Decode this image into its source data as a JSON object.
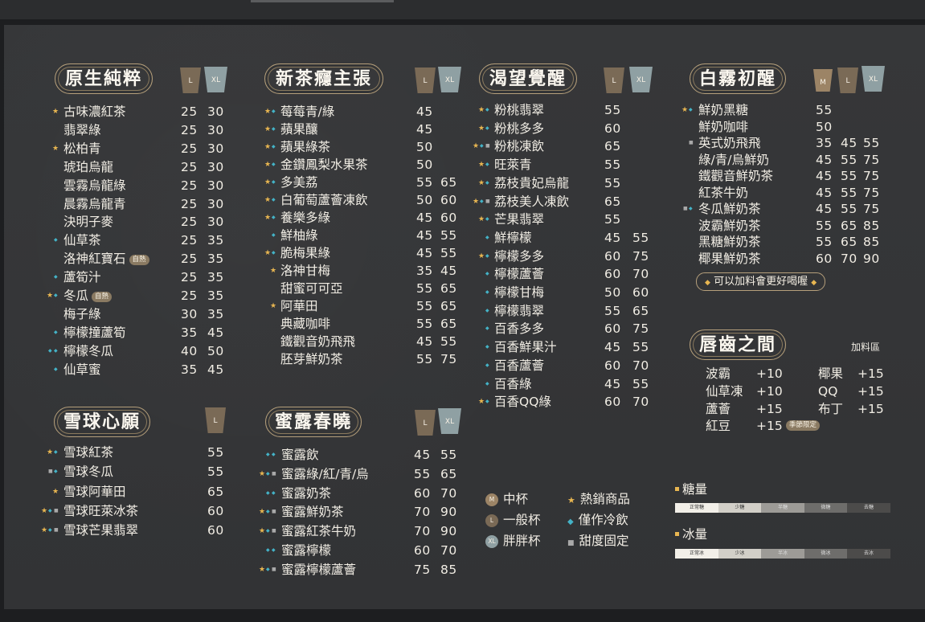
{
  "colors": {
    "board": "#333436",
    "gold": "#e8b651",
    "cold": "#44b3c7",
    "cup_L": "#7a6a56",
    "cup_XL": "#8fa0a3",
    "cup_M": "#9c8466"
  },
  "cups": {
    "M": "M",
    "L": "L",
    "XL": "XL"
  },
  "tag_natural": "自熱",
  "tag_seasonal": "季節限定",
  "sections": {
    "s1": {
      "title": "原生純粹",
      "items": [
        {
          "name": "古味濃紅茶",
          "L": "25",
          "XL": "30",
          "marks": [
            "star"
          ]
        },
        {
          "name": "翡翠綠",
          "L": "25",
          "XL": "30",
          "marks": []
        },
        {
          "name": "松柏青",
          "L": "25",
          "XL": "30",
          "marks": [
            "star"
          ]
        },
        {
          "name": "琥珀烏龍",
          "L": "25",
          "XL": "30",
          "marks": []
        },
        {
          "name": "雲霧烏龍綠",
          "L": "25",
          "XL": "30",
          "marks": []
        },
        {
          "name": "晨霧烏龍青",
          "L": "25",
          "XL": "30",
          "marks": []
        },
        {
          "name": "決明子麥",
          "L": "25",
          "XL": "30",
          "marks": []
        },
        {
          "name": "仙草茶",
          "L": "25",
          "XL": "35",
          "marks": [
            "cold"
          ]
        },
        {
          "name": "洛神紅寶石",
          "L": "25",
          "XL": "35",
          "marks": [],
          "tag": "自熱"
        },
        {
          "name": "蘆筍汁",
          "L": "25",
          "XL": "35",
          "marks": [
            "cold"
          ]
        },
        {
          "name": "冬瓜",
          "L": "25",
          "XL": "35",
          "marks": [
            "star",
            "cold"
          ],
          "tag": "自熱"
        },
        {
          "name": "梅子綠",
          "L": "30",
          "XL": "35",
          "marks": []
        },
        {
          "name": "檸檬撞蘆筍",
          "L": "35",
          "XL": "45",
          "marks": [
            "cold"
          ]
        },
        {
          "name": "檸檬冬瓜",
          "L": "40",
          "XL": "50",
          "marks": [
            "cold",
            "cold"
          ]
        },
        {
          "name": "仙草蜜",
          "L": "35",
          "XL": "45",
          "marks": [
            "cold"
          ]
        }
      ]
    },
    "s2": {
      "title": "新茶癮主張",
      "items": [
        {
          "name": "莓莓青/綠",
          "L": "45",
          "XL": "",
          "marks": [
            "star",
            "cold"
          ]
        },
        {
          "name": "蘋果釀",
          "L": "45",
          "XL": "",
          "marks": [
            "star",
            "cold"
          ]
        },
        {
          "name": "蘋果綠茶",
          "L": "50",
          "XL": "",
          "marks": [
            "star",
            "cold"
          ]
        },
        {
          "name": "金鑽鳳梨水果茶",
          "L": "50",
          "XL": "",
          "marks": [
            "star",
            "cold"
          ]
        },
        {
          "name": "多美荔",
          "L": "55",
          "XL": "65",
          "marks": [
            "star",
            "cold"
          ]
        },
        {
          "name": "白葡萄蘆薈凍飲",
          "L": "50",
          "XL": "60",
          "marks": [
            "star",
            "cold"
          ]
        },
        {
          "name": "養樂多綠",
          "L": "45",
          "XL": "60",
          "marks": [
            "star",
            "cold"
          ]
        },
        {
          "name": "鮮柚綠",
          "L": "45",
          "XL": "55",
          "marks": [
            "cold"
          ]
        },
        {
          "name": "脆梅果綠",
          "L": "45",
          "XL": "55",
          "marks": [
            "star",
            "cold"
          ]
        },
        {
          "name": "洛神甘梅",
          "L": "35",
          "XL": "45",
          "marks": [
            "star"
          ]
        },
        {
          "name": "甜蜜可可亞",
          "L": "55",
          "XL": "65",
          "marks": []
        },
        {
          "name": "阿華田",
          "L": "55",
          "XL": "65",
          "marks": [
            "star"
          ]
        },
        {
          "name": "典藏咖啡",
          "L": "55",
          "XL": "65",
          "marks": []
        },
        {
          "name": "鐵觀音奶飛飛",
          "L": "45",
          "XL": "55",
          "marks": []
        },
        {
          "name": "胚芽鮮奶茶",
          "L": "55",
          "XL": "75",
          "marks": []
        }
      ]
    },
    "s3": {
      "title": "渴望覺醒",
      "items": [
        {
          "name": "粉桃翡翠",
          "L": "55",
          "XL": "",
          "marks": [
            "star",
            "cold"
          ]
        },
        {
          "name": "粉桃多多",
          "L": "60",
          "XL": "",
          "marks": [
            "star",
            "cold"
          ]
        },
        {
          "name": "粉桃凍飲",
          "L": "65",
          "XL": "",
          "marks": [
            "star",
            "cold",
            "fix"
          ]
        },
        {
          "name": "旺萊青",
          "L": "55",
          "XL": "",
          "marks": [
            "star",
            "cold"
          ]
        },
        {
          "name": "荔枝貴妃烏龍",
          "L": "55",
          "XL": "",
          "marks": [
            "star",
            "cold"
          ]
        },
        {
          "name": "荔枝美人凍飲",
          "L": "65",
          "XL": "",
          "marks": [
            "star",
            "cold",
            "fix"
          ]
        },
        {
          "name": "芒果翡翠",
          "L": "55",
          "XL": "",
          "marks": [
            "star",
            "cold"
          ]
        },
        {
          "name": "鮮檸檬",
          "L": "45",
          "XL": "55",
          "marks": [
            "cold"
          ]
        },
        {
          "name": "檸檬多多",
          "L": "60",
          "XL": "75",
          "marks": [
            "star",
            "cold"
          ]
        },
        {
          "name": "檸檬蘆薈",
          "L": "60",
          "XL": "70",
          "marks": [
            "cold"
          ]
        },
        {
          "name": "檸檬甘梅",
          "L": "50",
          "XL": "60",
          "marks": [
            "cold"
          ]
        },
        {
          "name": "檸檬翡翠",
          "L": "55",
          "XL": "65",
          "marks": [
            "cold"
          ]
        },
        {
          "name": "百香多多",
          "L": "60",
          "XL": "75",
          "marks": [
            "cold"
          ]
        },
        {
          "name": "百香鮮果汁",
          "L": "45",
          "XL": "55",
          "marks": [
            "cold"
          ]
        },
        {
          "name": "百香蘆薈",
          "L": "60",
          "XL": "70",
          "marks": [
            "cold"
          ]
        },
        {
          "name": "百香綠",
          "L": "45",
          "XL": "55",
          "marks": [
            "cold"
          ]
        },
        {
          "name": "百香QQ綠",
          "L": "60",
          "XL": "70",
          "marks": [
            "star",
            "cold"
          ]
        }
      ]
    },
    "s4": {
      "title": "白霧初醒",
      "items": [
        {
          "name": "鮮奶黑糖",
          "M": "55",
          "L": "",
          "XL": "",
          "marks": [
            "star",
            "cold"
          ]
        },
        {
          "name": "鮮奶咖啡",
          "M": "50",
          "L": "",
          "XL": "",
          "marks": []
        },
        {
          "name": "英式奶飛飛",
          "M": "35",
          "L": "45",
          "XL": "55",
          "marks": [
            "fix"
          ]
        },
        {
          "name": "綠/青/烏鮮奶",
          "M": "45",
          "L": "55",
          "XL": "75",
          "marks": []
        },
        {
          "name": "鐵觀音鮮奶茶",
          "M": "45",
          "L": "55",
          "XL": "75",
          "marks": []
        },
        {
          "name": "紅茶牛奶",
          "M": "45",
          "L": "55",
          "XL": "75",
          "marks": []
        },
        {
          "name": "冬瓜鮮奶茶",
          "M": "45",
          "L": "55",
          "XL": "75",
          "marks": [
            "fix",
            "cold"
          ]
        },
        {
          "name": "波霸鮮奶茶",
          "M": "55",
          "L": "65",
          "XL": "85",
          "marks": []
        },
        {
          "name": "黑糖鮮奶茶",
          "M": "55",
          "L": "65",
          "XL": "85",
          "marks": []
        },
        {
          "name": "椰果鮮奶茶",
          "M": "60",
          "L": "70",
          "XL": "90",
          "marks": []
        }
      ],
      "note": "可以加料會更好喝喔"
    },
    "s5": {
      "title": "雪球心願",
      "items": [
        {
          "name": "雪球紅茶",
          "L": "55",
          "marks": [
            "star",
            "cold"
          ]
        },
        {
          "name": "雪球冬瓜",
          "L": "55",
          "marks": [
            "fix",
            "cold"
          ]
        },
        {
          "name": "雪球阿華田",
          "L": "65",
          "marks": [
            "star"
          ]
        },
        {
          "name": "雪球旺萊冰茶",
          "L": "60",
          "marks": [
            "star",
            "cold",
            "fix"
          ]
        },
        {
          "name": "雪球芒果翡翠",
          "L": "60",
          "marks": [
            "star",
            "cold",
            "fix"
          ]
        }
      ]
    },
    "s6": {
      "title": "蜜露春曉",
      "items": [
        {
          "name": "蜜露飲",
          "L": "45",
          "XL": "55",
          "marks": [
            "cold",
            "cold"
          ]
        },
        {
          "name": "蜜露綠/紅/青/烏",
          "L": "55",
          "XL": "65",
          "marks": [
            "star",
            "cold",
            "fix"
          ]
        },
        {
          "name": "蜜露奶茶",
          "L": "60",
          "XL": "70",
          "marks": [
            "cold",
            "cold"
          ]
        },
        {
          "name": "蜜露鮮奶茶",
          "L": "70",
          "XL": "90",
          "marks": [
            "star",
            "cold",
            "fix"
          ]
        },
        {
          "name": "蜜露紅茶牛奶",
          "L": "70",
          "XL": "90",
          "marks": [
            "star",
            "cold",
            "fix"
          ]
        },
        {
          "name": "蜜露檸檬",
          "L": "60",
          "XL": "70",
          "marks": [
            "cold",
            "cold"
          ]
        },
        {
          "name": "蜜露檸檬蘆薈",
          "L": "75",
          "XL": "85",
          "marks": [
            "star",
            "cold",
            "fix"
          ]
        }
      ]
    },
    "s7": {
      "title": "唇齒之間",
      "side_label": "加料區",
      "toppings": [
        {
          "name": "波霸",
          "price": "+10"
        },
        {
          "name": "仙草凍",
          "price": "+10"
        },
        {
          "name": "蘆薈",
          "price": "+15"
        },
        {
          "name": "紅豆",
          "price": "+15",
          "tag": "季節限定"
        },
        {
          "name": "椰果",
          "price": "+15"
        },
        {
          "name": "QQ",
          "price": "+15"
        },
        {
          "name": "布丁",
          "price": "+15"
        }
      ]
    }
  },
  "legend": {
    "cup_m": "中杯",
    "cup_l": "一般杯",
    "cup_xl": "胖胖杯",
    "hot_seller": "熱銷商品",
    "cold_only": "僅作冷飲",
    "fixed_sweet": "甜度固定"
  },
  "sugar": {
    "title": "糖量",
    "levels": [
      "正常糖",
      "少糖",
      "半糖",
      "微糖",
      "去糖"
    ]
  },
  "ice": {
    "title": "冰量",
    "levels": [
      "正常冰",
      "少冰",
      "半冰",
      "微冰",
      "去冰"
    ]
  }
}
